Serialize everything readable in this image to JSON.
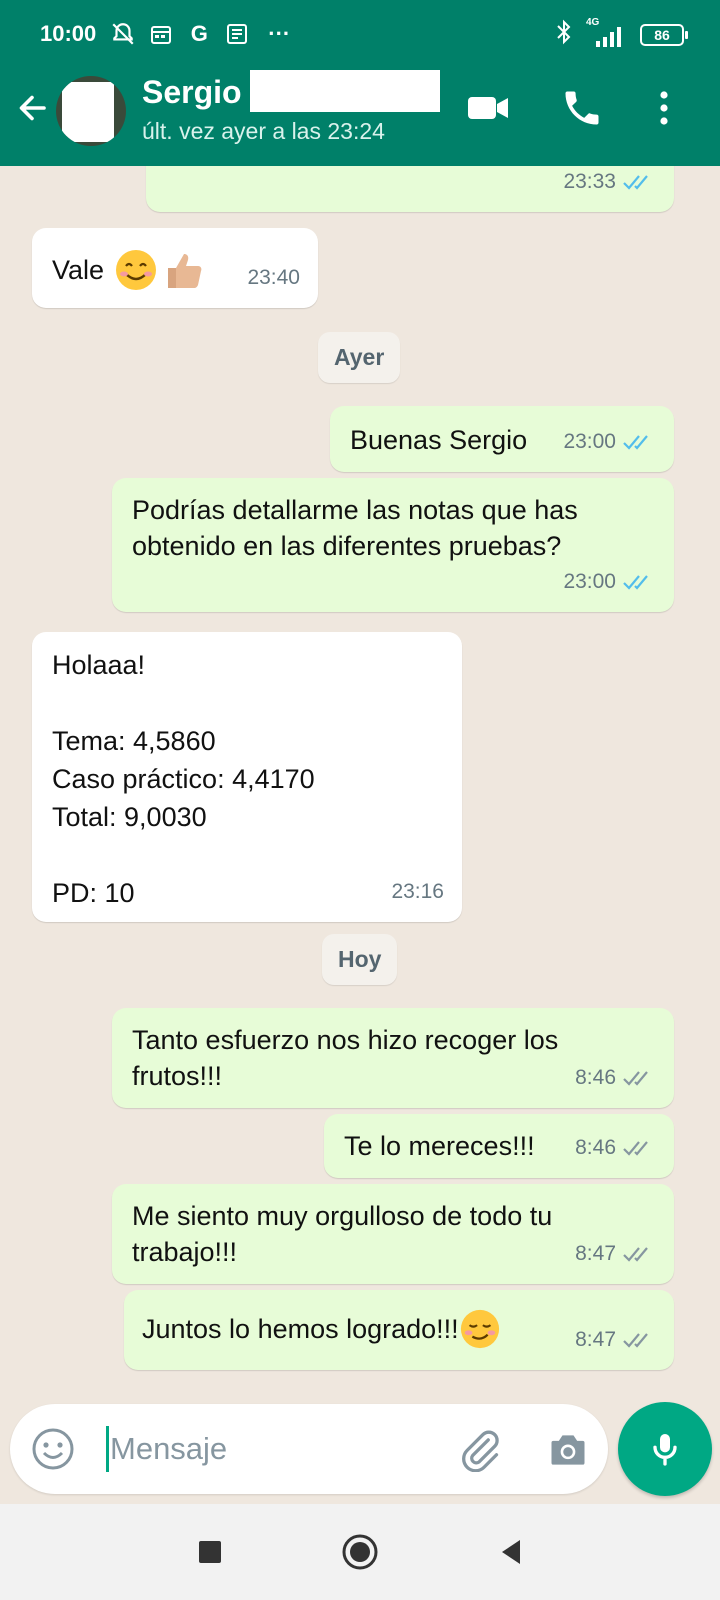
{
  "status_bar": {
    "time": "10:00",
    "icons": [
      "mute-bell-icon",
      "calendar-icon",
      "google-icon",
      "news-icon",
      "more-dots-icon"
    ],
    "right_icons": [
      "bluetooth-icon",
      "signal-4g-icon"
    ],
    "network": "4G",
    "battery": "86"
  },
  "header": {
    "contact_name": "Sergio",
    "last_seen": "últ. vez ayer a las 23:24",
    "accent": "#008069"
  },
  "messages": [
    {
      "dir": "out",
      "text": "",
      "time": "23:33",
      "ticks": "read"
    },
    {
      "dir": "in",
      "text": "Vale",
      "emoji": [
        "smiling-face-icon",
        "thumbs-up-icon"
      ],
      "time": "23:40"
    },
    {
      "type": "date",
      "label": "Ayer"
    },
    {
      "dir": "out",
      "text": "Buenas Sergio",
      "time": "23:00",
      "ticks": "read"
    },
    {
      "dir": "out",
      "text": "Podrías detallarme las notas que has obtenido en las diferentes pruebas?",
      "time": "23:00",
      "ticks": "read"
    },
    {
      "dir": "in",
      "text": "Holaaa!\n\nTema: 4,5860\nCaso práctico: 4,4170\nTotal: 9,0030\n\nPD: 10",
      "time": "23:16"
    },
    {
      "type": "date",
      "label": "Hoy"
    },
    {
      "dir": "out",
      "text": "Tanto esfuerzo nos hizo recoger los frutos!!!",
      "time": "8:46",
      "ticks": "delivered"
    },
    {
      "dir": "out",
      "text": "Te lo mereces!!!",
      "time": "8:46",
      "ticks": "delivered"
    },
    {
      "dir": "out",
      "text": "Me siento muy orgulloso de todo tu trabajo!!!",
      "time": "8:47",
      "ticks": "delivered"
    },
    {
      "dir": "out",
      "text": "Juntos lo hemos logrado!!!",
      "emoji": [
        "smirking-face-icon"
      ],
      "time": "8:47",
      "ticks": "delivered"
    }
  ],
  "composer": {
    "placeholder": "Mensaje"
  },
  "colors": {
    "outgoing_bubble": "#e7fcd7",
    "incoming_bubble": "#ffffff",
    "read_ticks": "#53bdeb",
    "delivered_ticks": "#8696a0",
    "mic_button": "#00a884"
  }
}
